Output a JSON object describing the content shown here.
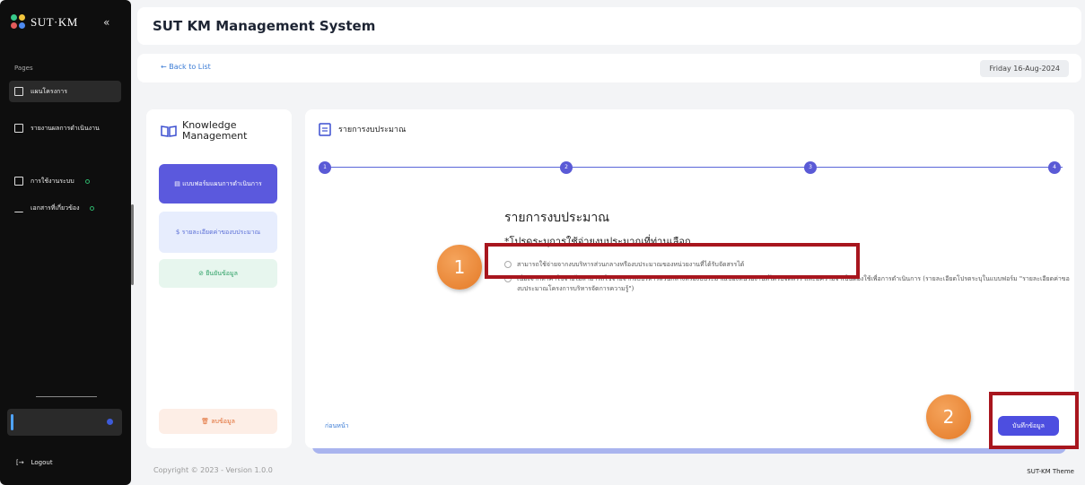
{
  "sidebar": {
    "logo": "SUT·KM",
    "collapse_icon": "«",
    "pages_label": "Pages",
    "items": [
      {
        "label": "แผนโครงการ"
      },
      {
        "label": "รายงานผลการดำเนินงาน"
      },
      {
        "label": "การใช้งานระบบ"
      },
      {
        "label": "เอกสารที่เกี่ยวข้อง"
      }
    ],
    "logout": "Logout"
  },
  "header": {
    "title": "SUT KM Management System",
    "back_link": "← Back to List",
    "date": "Friday 16-Aug-2024"
  },
  "left_panel": {
    "km_title_1": "Knowledge",
    "km_title_2": "Management",
    "steps": [
      {
        "label": "แบบฟอร์มแผนการดำเนินการ"
      },
      {
        "label": "รายละเอียดค่าของบประมาณ"
      },
      {
        "label": "ยืนยันข้อมูล"
      }
    ],
    "delete_label": "ลบข้อมูล"
  },
  "main": {
    "card_title": "รายการงบประมาณ",
    "step_numbers": [
      "1",
      "2",
      "3",
      "4"
    ],
    "form_title": "รายการงบประมาณ",
    "form_subtitle": "*โปรดระบุการใช้จ่ายงบประมาณที่ท่านเลือก",
    "option1": "สามารถใช้จ่ายจากงบบริหารส่วนกลางหรืองบประมาณของหน่วยงานที่ได้รับจัดสรรได้",
    "option2": "เนื่องจากหาค่าใช้จ่ายไม่สามารถใช้จ่ายจากงบบริหารส่วนกลางหรืองบประมาณของหน่วยงานที่ได้รับจัดสรร และมีความจำเป็นต้องใช้เพื่อการดำเนินการ (รายละเอียดโปรดระบุในแบบฟอร์ม \"รายละเอียดค่าของบประมาณโครงการบริหารจัดการความรู้\")",
    "prev_label": "ก่อนหน้า",
    "save_label": "บันทึกข้อมูล"
  },
  "annotations": {
    "badge1": "1",
    "badge2": "2"
  },
  "footer": {
    "copyright": "Copyright © 2023 - Version 1.0.0",
    "theme": "SUT-KM Theme"
  }
}
